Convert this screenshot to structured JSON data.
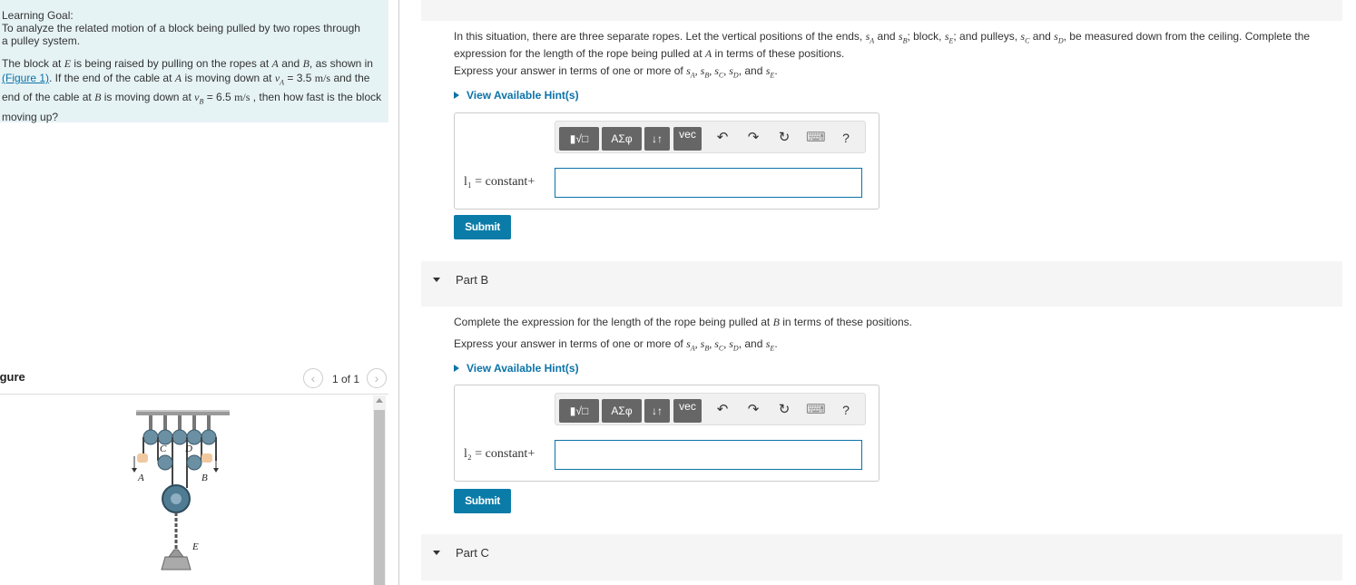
{
  "learning_goal": {
    "title": "Learning Goal:",
    "text": "To analyze the related motion of a block being pulled by two ropes through a pulley system.",
    "problem_p1": "The block at ",
    "problem_E": "E",
    "problem_p2": " is being raised by pulling on the ropes at ",
    "problem_A": "A",
    "problem_and": " and ",
    "problem_B": "B",
    "problem_p3": ", as shown in",
    "figure_link": "(Figure 1)",
    "problem_p4": ". If the end of the cable at ",
    "problem_p5": " is moving down at ",
    "vA": "v",
    "vA_sub": "A",
    "vA_val": " = 3.5 ",
    "unit1": "m/s",
    "problem_p6": " and the end of the cable at ",
    "problem_p7": " is moving down at ",
    "vB_val": " = 6.5 ",
    "unit2": "m/s",
    "problem_p8": " , then how fast is the block moving up?"
  },
  "figure": {
    "title": "igure",
    "count": "1 of 1",
    "labels": {
      "C": "C",
      "D": "D",
      "A": "A",
      "B": "B",
      "E": "E"
    }
  },
  "part_a": {
    "text1": "In this situation, there are three separate ropes. Let the vertical positions of the ends, ",
    "text2": "; block, ",
    "text3": "; and pulleys, ",
    "text4": ", be measured down from the ceiling. Complete the expression for the length of the rope being pulled at ",
    "text5": " in terms of these positions.",
    "instruction": "Express your answer in terms of one or more of ",
    "hint": "View Available Hint(s)",
    "answer_label": "l₁ = constant+",
    "submit": "Submit"
  },
  "part_b": {
    "title": "Part B",
    "text1": "Complete the expression for the length of the rope being pulled at ",
    "text2": " in terms of these positions.",
    "instruction": "Express your answer in terms of one or more of ",
    "hint": "View Available Hint(s)",
    "answer_label": "l₂ = constant+",
    "submit": "Submit"
  },
  "part_c": {
    "title": "Part C"
  },
  "toolbar": {
    "sqrt": "▮√□",
    "greek": "ΑΣφ",
    "arrows": "↓↑",
    "vec": "vec",
    "undo": "↶",
    "redo": "↷",
    "reset": "↻",
    "keyboard": "⌨",
    "help": "?"
  },
  "symbols": {
    "sA": "s",
    "A": "A",
    "sB": "s",
    "B": "B",
    "sE": "s",
    "E": "E",
    "sC": "s",
    "C": "C",
    "sD": "s",
    "D": "D",
    "and": "and"
  },
  "colors": {
    "accent": "#0b73a8",
    "goal_bg": "#e6f3f5",
    "submit_bg": "#0b7ca8"
  }
}
